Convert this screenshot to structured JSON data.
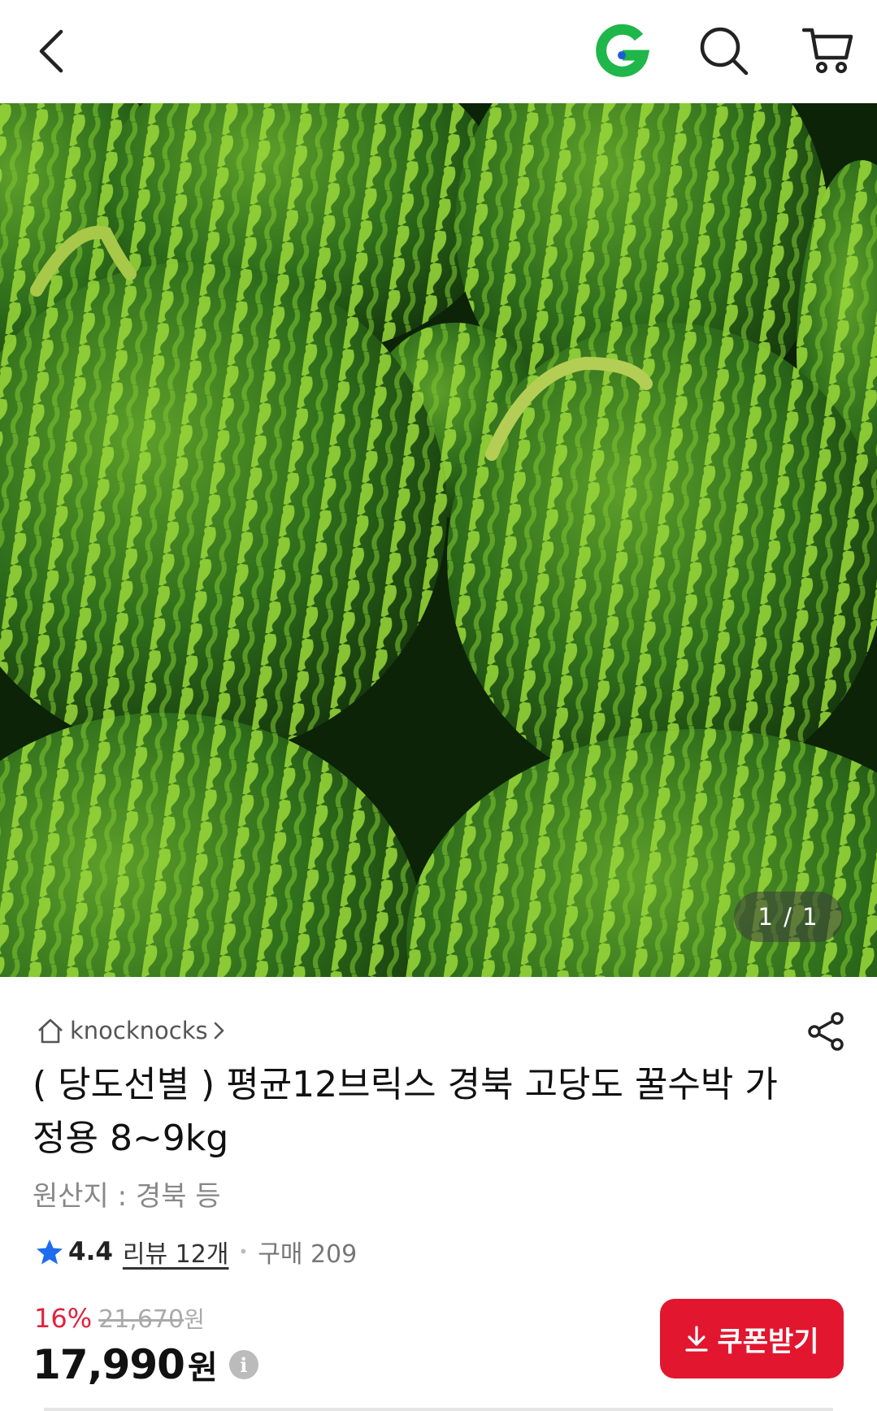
{
  "header": {
    "back_icon": "chevron-left-icon",
    "logo_icon": "g-logo-icon",
    "search_icon": "search-icon",
    "cart_icon": "cart-icon",
    "logo_color": "#1fb64a"
  },
  "gallery": {
    "image": "watermelon-product-photo",
    "counter": "1 / 1"
  },
  "product": {
    "seller": "knocknocks",
    "title": "( 당도선별 ) 평균12브릭스 경북 고당도 꿀수박 가정용 8~9kg",
    "origin": "원산지 : 경북 등",
    "rating": "4.4",
    "reviews": "리뷰 12개",
    "purchases": "구매 209",
    "discount": "16%",
    "original_price": "21,670",
    "original_unit": "원",
    "price": "17,990",
    "price_unit": "원",
    "info_icon": "i"
  },
  "actions": {
    "share_icon": "share-icon",
    "coupon_label": "쿠폰받기",
    "coupon_color": "#e2162f",
    "discount_color": "#e2213d"
  }
}
